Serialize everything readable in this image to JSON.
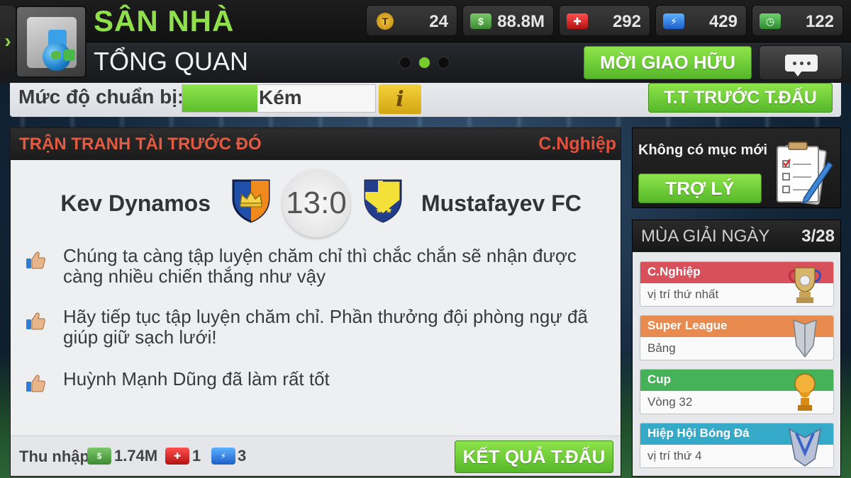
{
  "header": {
    "title": "SÂN NHÀ",
    "subtitle": "TỔNG QUAN",
    "resources": [
      {
        "icon": "token-coin-icon",
        "value": "24"
      },
      {
        "icon": "cash-icon",
        "value": "88.8M"
      },
      {
        "icon": "medical-kit-icon",
        "value": "292"
      },
      {
        "icon": "energy-icon",
        "value": "429"
      },
      {
        "icon": "timer-icon",
        "value": "122"
      }
    ],
    "invite_label": "MỜI GIAO HỮU",
    "pager_active_index": 1
  },
  "readiness": {
    "label": "Mức độ chuẩn bị:",
    "level_text": "Kém",
    "level_fraction": 0.39,
    "info_label": "i",
    "prematch_label": "T.T TRƯỚC T.ĐẤU"
  },
  "match": {
    "title": "TRẬN TRANH TÀI TRƯỚC ĐÓ",
    "competition": "C.Nghiệp",
    "home_team": "Kev Dynamos",
    "away_team": "Mustafayev FC",
    "score": "13:0",
    "messages": [
      "Chúng ta càng tập luyện chăm chỉ thì chắc chắn sẽ nhận được càng nhiều chiến thắng như vậy",
      "Hãy tiếp tục tập luyện chăm chỉ. Phần thưởng đội phòng ngự đã giúp giữ sạch lưới!",
      "Huỳnh Mạnh Dũng đã làm rất tốt"
    ],
    "income_label": "Thu nhập:",
    "income_cash": "1.74M",
    "income_medical": "1",
    "income_energy": "3",
    "result_label": "KẾT QUẢ T.ĐẤU"
  },
  "assistant": {
    "text": "Không có mục mới",
    "button_label": "TRỢ LÝ"
  },
  "season": {
    "title": "MÙA GIẢI NGÀY",
    "day": "3/28",
    "competitions": [
      {
        "name": "C.Nghiệp",
        "detail": "vị trí thứ nhất",
        "color": "#d8505a"
      },
      {
        "name": "Super League",
        "detail": "Bảng",
        "color": "#e98a4e"
      },
      {
        "name": "Cup",
        "detail": "Vòng 32",
        "color": "#45b25a"
      },
      {
        "name": "Hiệp Hội Bóng Đá",
        "detail": "vị trí thứ 4",
        "color": "#35a9c8"
      }
    ]
  },
  "colors": {
    "accent_green": "#8fe04a",
    "header_red": "#e25b43"
  }
}
